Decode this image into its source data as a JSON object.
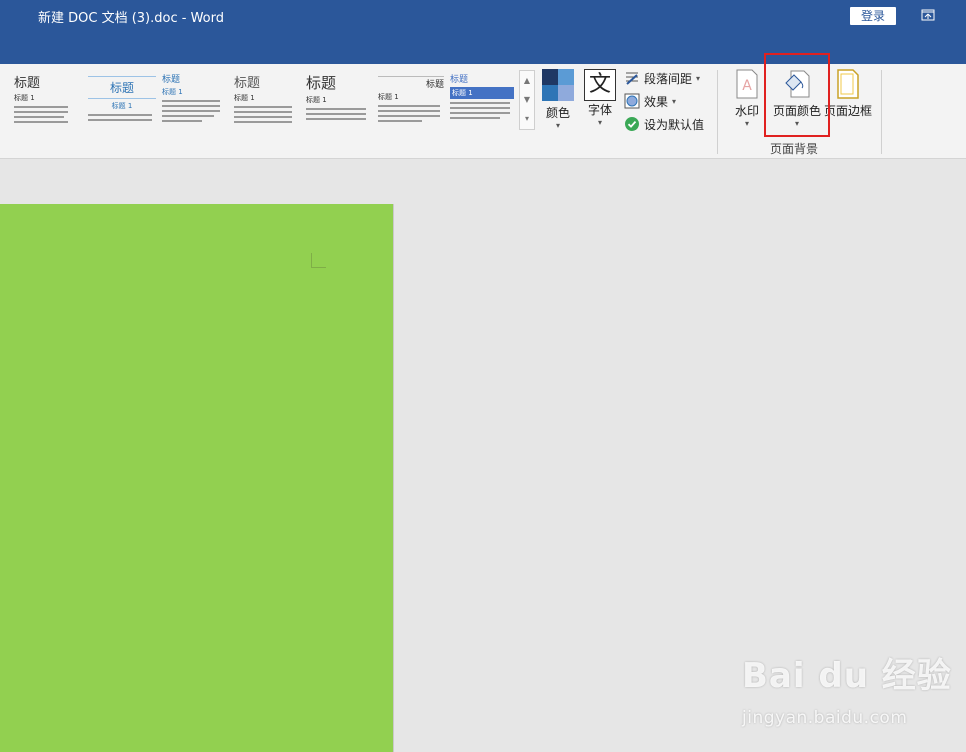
{
  "titlebar": {
    "title": "新建 DOC 文档 (3).doc  -  Word",
    "signin_label": "登录"
  },
  "style_gallery": [
    {
      "heading": "标题",
      "subheading": "标题 1",
      "variant": "default"
    },
    {
      "heading": "标题",
      "subheading": "标题 1",
      "variant": "centered"
    },
    {
      "heading": "标题",
      "subheading": "标题 1",
      "variant": "small"
    },
    {
      "heading": "标题",
      "subheading": "标题 1",
      "variant": "basic"
    },
    {
      "heading": "标题",
      "subheading": "标题 1",
      "variant": "large"
    },
    {
      "heading": "标题",
      "subheading": "标题 1",
      "variant": "right"
    },
    {
      "heading": "标题",
      "subheading": "标题 1",
      "variant": "banded"
    }
  ],
  "design": {
    "colors_label": "颜色",
    "fonts_label": "字体",
    "fonts_glyph": "文",
    "paragraph_spacing_label": "段落间距",
    "effects_label": "效果",
    "set_default_label": "设为默认值"
  },
  "page_background": {
    "group_label": "页面背景",
    "watermark_label": "水印",
    "page_color_label": "页面颜色",
    "page_borders_label": "页面边框"
  },
  "document": {
    "page_color": "#92d050"
  },
  "watermark_overlay": {
    "brand": "Bai du 经验",
    "url": "jingyan.baidu.com"
  },
  "colors": {
    "titlebar": "#2b579a",
    "highlight": "#e0201f",
    "page": "#92d050"
  }
}
